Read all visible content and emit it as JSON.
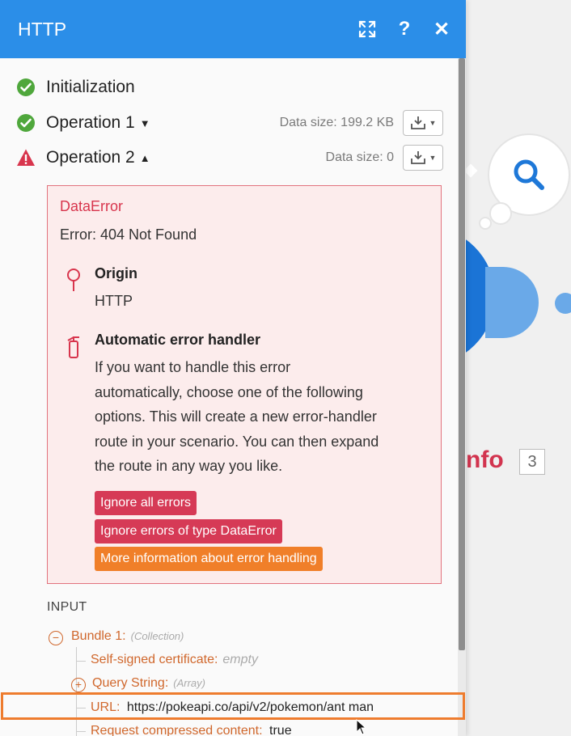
{
  "panel": {
    "title": "HTTP",
    "header_buttons": [
      {
        "name": "expand-icon",
        "glyph": "⤧"
      },
      {
        "name": "help-icon",
        "glyph": "?"
      },
      {
        "name": "close-icon",
        "glyph": "✕"
      }
    ],
    "accent_color": "#2b8ee8"
  },
  "operations": [
    {
      "label": "Initialization",
      "status": "success",
      "data_size": "",
      "caret": ""
    },
    {
      "label": "Operation 1",
      "status": "success",
      "data_size": "Data size: 199.2 KB",
      "caret": "▼"
    },
    {
      "label": "Operation 2",
      "status": "error",
      "data_size": "Data size: 0",
      "caret": "▲"
    }
  ],
  "error": {
    "type": "DataError",
    "message": "Error: 404 Not Found",
    "origin_label": "Origin",
    "origin_value": "HTTP",
    "handler_title": "Automatic error handler",
    "handler_text": [
      "If you want to handle this error",
      "automatically, choose one of the following",
      "options. This will create a new error-handler",
      "route in your scenario. You can then expand",
      "the route in any way you like."
    ],
    "buttons": {
      "ignore_all": "Ignore all errors",
      "ignore_type": "Ignore errors of type DataError",
      "more_info": "More information about error handling"
    }
  },
  "input": {
    "label": "INPUT",
    "bundle_key": "Bundle 1:",
    "bundle_type": "(Collection)",
    "self_signed_key": "Self-signed certificate:",
    "self_signed_value": "empty",
    "query_key": "Query String:",
    "query_type": "(Array)",
    "url_key": "URL:",
    "url_value": "https://pokeapi.co/api/v2/pokemon/ant man",
    "compressed_key": "Request compressed content:",
    "compressed_value": "true"
  },
  "background": {
    "module_name": "nfo",
    "module_count": "3"
  }
}
